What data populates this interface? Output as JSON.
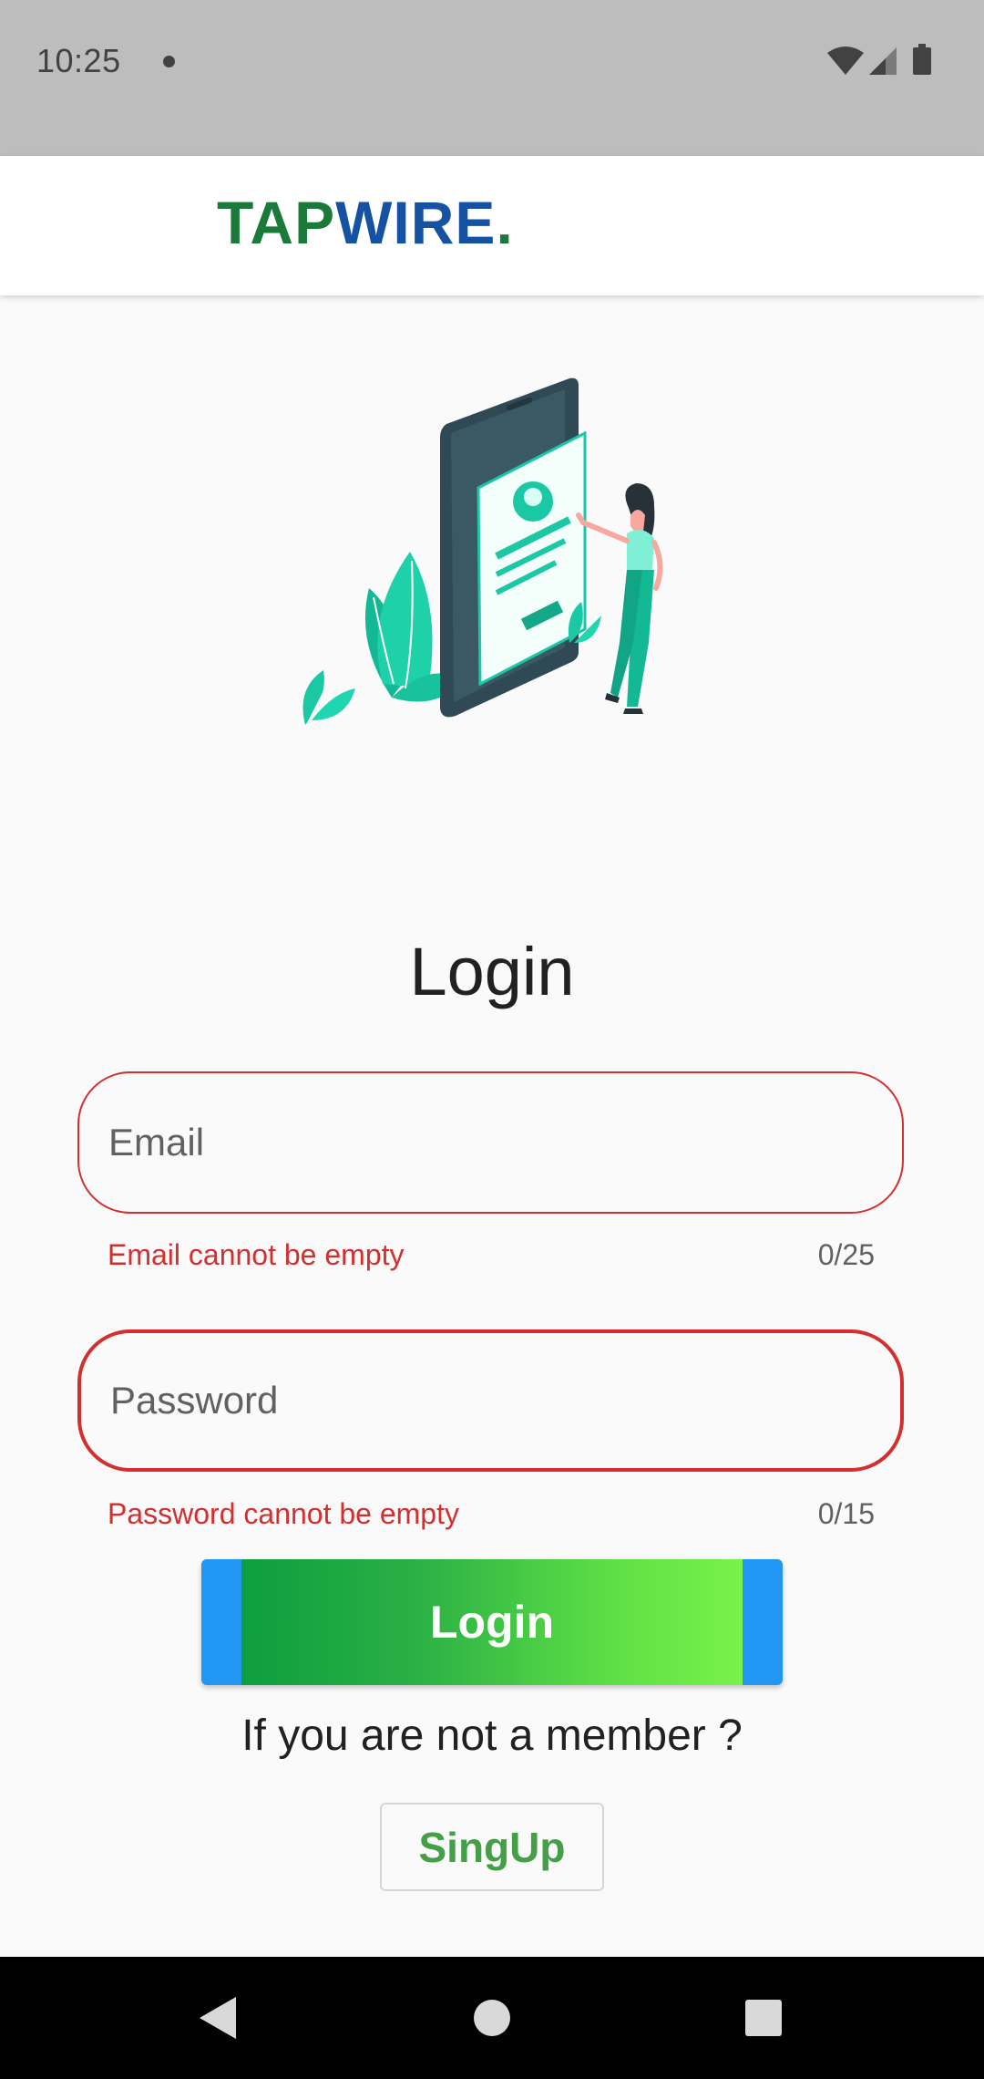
{
  "status_bar": {
    "time": "10:25",
    "icons": [
      "notification-dot-icon",
      "wifi-icon",
      "cellular-signal-icon",
      "battery-icon"
    ]
  },
  "app_bar": {
    "brand_part1": "TAP",
    "brand_part2": "WIRE",
    "brand_dot": ".",
    "colors": {
      "tap": "#1b7a3a",
      "wire": "#1552a3"
    }
  },
  "form": {
    "title": "Login",
    "email": {
      "placeholder": "Email",
      "value": "",
      "error": "Email cannot be empty",
      "counter": "0/25"
    },
    "password": {
      "placeholder": "Password",
      "value": "",
      "error": "Password cannot be empty",
      "counter": "0/15"
    },
    "login_label": "Login",
    "member_prompt": "If you are not a member ?",
    "signup_label": "SingUp"
  },
  "colors": {
    "error": "#d32f2f",
    "button_edge": "#2196f3",
    "gradient_start": "#0d9e3f",
    "gradient_end": "#79f24a",
    "signup_text": "#43a047"
  },
  "nav_bar": {
    "icons": [
      "back-icon",
      "home-icon",
      "recents-icon"
    ]
  }
}
